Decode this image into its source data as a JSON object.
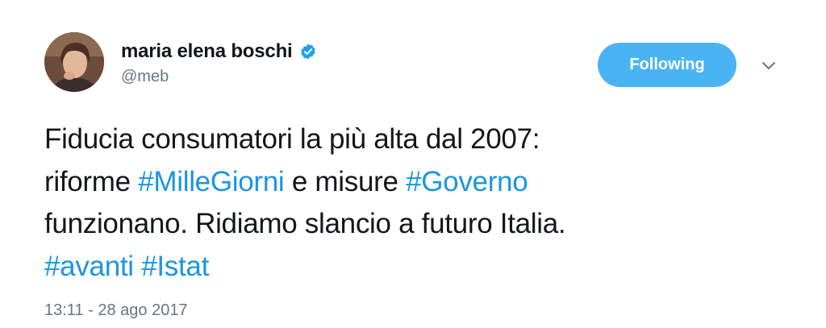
{
  "author": {
    "display_name": "maria elena boschi",
    "handle": "@meb",
    "verified": true
  },
  "follow_button": {
    "label": "Following",
    "color": "#4ab3f4"
  },
  "tweet": {
    "line1": "Fiducia consumatori la più alta dal 2007:",
    "line2_a": "riforme ",
    "hashtag_1": "#MilleGiorni",
    "line2_b": " e misure ",
    "hashtag_2": "#Governo",
    "line3": "funzionano. Ridiamo slancio a futuro Italia.",
    "hashtag_3": "#avanti",
    "line4_sep": " ",
    "hashtag_4": "#Istat"
  },
  "timestamp": "13:11 - 28 ago 2017",
  "colors": {
    "hashtag": "#1b95e0",
    "secondary_text": "#657786",
    "verified_badge": "#1da1f2"
  }
}
